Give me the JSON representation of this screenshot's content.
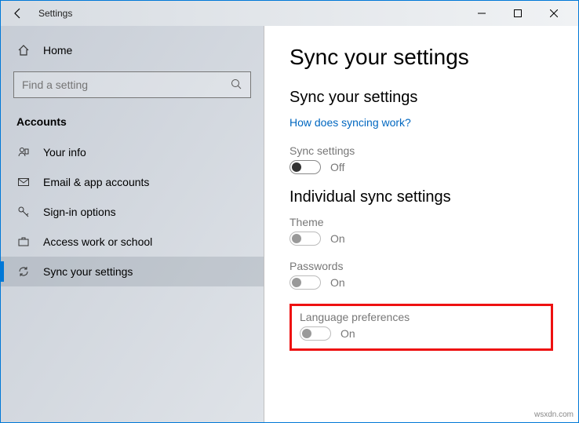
{
  "window": {
    "title": "Settings"
  },
  "sidebar": {
    "home": "Home",
    "search_placeholder": "Find a setting",
    "category": "Accounts",
    "items": [
      {
        "label": "Your info"
      },
      {
        "label": "Email & app accounts"
      },
      {
        "label": "Sign-in options"
      },
      {
        "label": "Access work or school"
      },
      {
        "label": "Sync your settings"
      }
    ]
  },
  "content": {
    "page_title": "Sync your settings",
    "section1_title": "Sync your settings",
    "link": "How does syncing work?",
    "sync_settings": {
      "label": "Sync settings",
      "state": "Off"
    },
    "section2_title": "Individual sync settings",
    "theme": {
      "label": "Theme",
      "state": "On"
    },
    "passwords": {
      "label": "Passwords",
      "state": "On"
    },
    "language": {
      "label": "Language preferences",
      "state": "On"
    }
  },
  "watermark": "wsxdn.com"
}
